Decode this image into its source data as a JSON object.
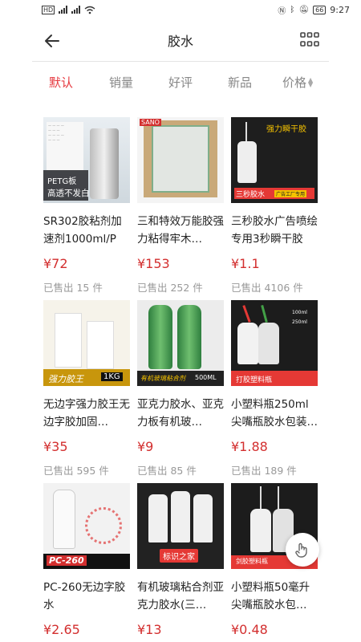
{
  "status_bar": {
    "left_icons": [
      "hd-icon",
      "signal-icon",
      "signal-icon",
      "wifi-icon"
    ],
    "battery": "66",
    "time": "9:27"
  },
  "header": {
    "title": "胶水"
  },
  "tabs": [
    {
      "label": "默认",
      "active": true
    },
    {
      "label": "销量",
      "active": false
    },
    {
      "label": "好评",
      "active": false
    },
    {
      "label": "新品",
      "active": false
    },
    {
      "label": "价格",
      "active": false
    }
  ],
  "products": [
    {
      "name": "SR302胶粘剂加速剂1000ml/PC…",
      "price": "¥72",
      "sold": "已售出 15 件",
      "image_text": [
        "PETG板",
        "高透不发白"
      ]
    },
    {
      "name": "三和特效万能胶强力粘得牢木…",
      "price": "¥153",
      "sold": "已售出 252 件",
      "image_text": [
        "SANO"
      ]
    },
    {
      "name": "三秒胶水广告喷绘专用3秒瞬干胶",
      "price": "¥1.1",
      "sold": "已售出 4106 件",
      "image_text": [
        "强力瞬干胶",
        "三秒胶水",
        "广告工厂专用"
      ]
    },
    {
      "name": "无边字强力胶王无边字胶加固…",
      "price": "¥35",
      "sold": "已售出 595 件",
      "image_text": [
        "强力胶王",
        "1KG"
      ]
    },
    {
      "name": "亚克力胶水、亚克力板有机玻…",
      "price": "¥9",
      "sold": "已售出 85 件",
      "image_text": [
        "有机玻璃粘合剂",
        "500ML"
      ]
    },
    {
      "name": "小塑料瓶250ml尖嘴瓶胶水包装…",
      "price": "¥1.88",
      "sold": "已售出 189 件",
      "image_text": [
        "打胶塑料瓶",
        "100ml",
        "250ml"
      ]
    },
    {
      "name": "PC-260无边字胶水",
      "price": "¥2.65",
      "sold": "",
      "image_text": [
        "PC-260"
      ]
    },
    {
      "name": "有机玻璃粘合剂亚克力胶水(三…",
      "price": "¥13",
      "sold": "",
      "image_text": [
        "标识之家"
      ]
    },
    {
      "name": "小塑料瓶50毫升尖嘴瓶胶水包…",
      "price": "¥0.48",
      "sold": "",
      "image_text": [
        "剑胶塑料瓶"
      ]
    }
  ],
  "icons": {
    "back": "arrow-left-icon",
    "grid": "grid-view-icon",
    "float": "hand-gesture-icon"
  },
  "colors": {
    "accent": "#e6383e",
    "price": "#d32f2f",
    "muted": "#999999"
  }
}
